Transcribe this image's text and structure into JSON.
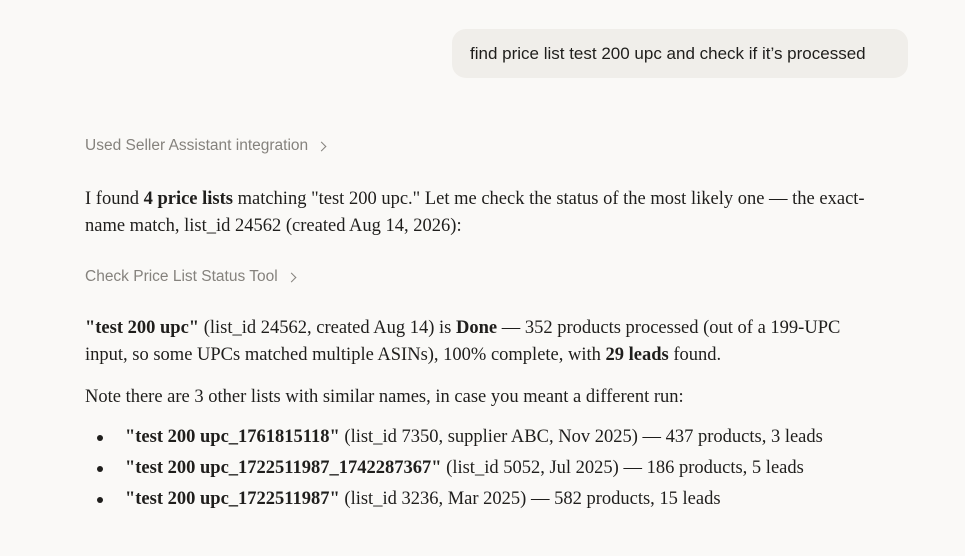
{
  "user_message": "find price list test 200 upc and check if it’s processed",
  "tool_calls": [
    {
      "label": "Used Seller Assistant integration"
    },
    {
      "label": "Check Price List Status Tool"
    }
  ],
  "paragraph1": {
    "t1": "I found ",
    "b1": "4 price lists",
    "t2": " matching \"test 200 upc.\" Let me check the status of the most likely one — the exact-name match, list_id 24562 (created Aug 14, 2026):"
  },
  "paragraph2": {
    "b1": "\"test 200 upc\"",
    "t1": " (list_id 24562, created Aug 14) is ",
    "b2": "Done",
    "t2": " — 352 products processed (out of a 199-UPC input, so some UPCs matched multiple ASINs), 100% complete, with ",
    "b3": "29 leads",
    "t3": " found."
  },
  "paragraph3": "Note there are 3 other lists with similar names, in case you meant a different run:",
  "other_lists": [
    {
      "name": "\"test 200 upc_1761815118\"",
      "details": " (list_id 7350, supplier ABC, Nov 2025) — 437 products, 3 leads"
    },
    {
      "name": "\"test 200 upc_1722511987_1742287367\"",
      "details": " (list_id 5052, Jul 2025) — 186 products, 5 leads"
    },
    {
      "name": "\"test 200 upc_1722511987\"",
      "details": " (list_id 3236, Mar 2025) — 582 products, 15 leads"
    }
  ]
}
